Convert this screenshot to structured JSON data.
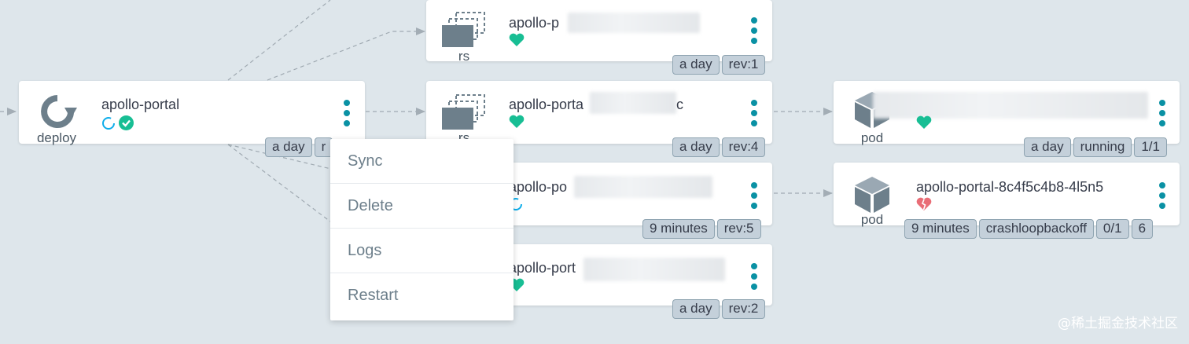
{
  "deploy": {
    "name": "apollo-portal",
    "kind": "deploy",
    "tags": [
      "a day",
      "r"
    ]
  },
  "replicasets": [
    {
      "name": "apollo-p",
      "kind": "rs",
      "tags": [
        "a day",
        "rev:1"
      ],
      "health": "healthy"
    },
    {
      "name": "apollo-porta",
      "name_suffix": "c",
      "kind": "rs",
      "tags": [
        "a day",
        "rev:4"
      ],
      "health": "healthy"
    },
    {
      "name": "apollo-po",
      "kind": "rs",
      "tags": [
        "9 minutes",
        "rev:5"
      ],
      "health": "progressing"
    },
    {
      "name": "apollo-port",
      "kind": "rs",
      "tags": [
        "a day",
        "rev:2"
      ],
      "health": "healthy"
    }
  ],
  "pods": [
    {
      "name": "",
      "kind": "pod",
      "tags": [
        "a day",
        "running",
        "1/1"
      ],
      "health": "healthy"
    },
    {
      "name": "apollo-portal-8c4f5c4b8-4l5n5",
      "kind": "pod",
      "tags": [
        "9 minutes",
        "crashloopbackoff",
        "0/1",
        "6"
      ],
      "health": "degraded"
    }
  ],
  "context_menu": {
    "items": [
      "Sync",
      "Delete",
      "Logs",
      "Restart"
    ]
  },
  "watermark": "@稀土掘金技术社区",
  "colors": {
    "background": "#dee6eb",
    "accent": "#0a91a4",
    "healthy": "#18be94",
    "degraded": "#e96d76",
    "tag_bg": "#c4d0da"
  },
  "icons": {
    "deploy": "sync-arrow-icon",
    "rs": "stacked-layers-icon",
    "pod": "cube-icon",
    "healthy": "heart-icon",
    "degraded": "broken-heart-icon",
    "synced": "check-circle-icon",
    "progressing": "circle-notch-icon"
  }
}
